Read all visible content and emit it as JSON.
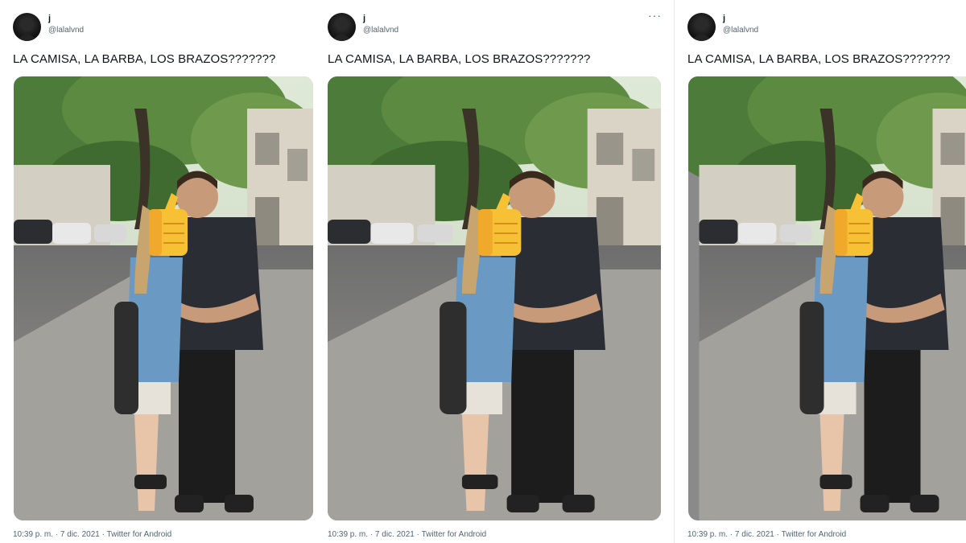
{
  "tweet": {
    "author_name": "j",
    "author_handle": "@lalalvnd",
    "text": "LA CAMISA, LA BARBA, LOS BRAZOS???????",
    "timestamp": "10:39 p. m. · 7 dic. 2021 · ",
    "source": "Twitter for Android"
  },
  "icons": {
    "more": "more-options-icon",
    "emoji": "thumbs-up-emoji",
    "avatar": "avatar"
  },
  "colors": {
    "text": "#0f1419",
    "muted": "#536471",
    "divider": "#e6e9eb",
    "emoji": "#f7c136"
  }
}
